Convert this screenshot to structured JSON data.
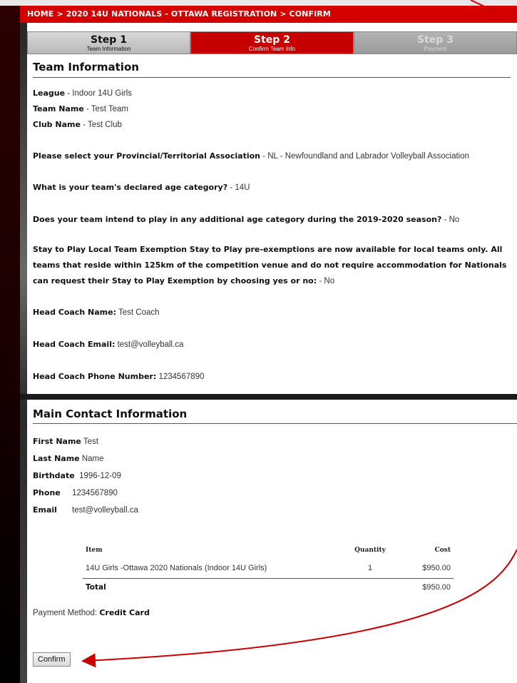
{
  "breadcrumb": "HOME > 2020 14U NATIONALS - OTTAWA REGISTRATION > CONFIRM",
  "steps": [
    {
      "title": "Step 1",
      "sub": "Team Information"
    },
    {
      "title": "Step 2",
      "sub": "Confirm Team Info"
    },
    {
      "title": "Step 3",
      "sub": "Payment"
    }
  ],
  "team": {
    "heading": "Team Information",
    "league_label": "League",
    "league": "Indoor 14U Girls",
    "team_name_label": "Team Name",
    "team_name": "Test Team",
    "club_name_label": "Club Name",
    "club_name": "Test Club",
    "q_association": "Please select your Provincial/Territorial Association",
    "a_association": "NL - Newfoundland and Labrador Volleyball Association",
    "q_age": "What is your team's declared age category?",
    "a_age": "14U",
    "q_additional": "Does your team intend to play in any additional age category during the 2019-2020 season?",
    "a_additional": "No",
    "q_stay": "Stay to Play Local Team Exemption Stay to Play pre-exemptions are now available for local teams only. All teams that reside within 125km of the competition venue and do not require accommodation for Nationals can request their Stay to Play Exemption by choosing yes or no:",
    "a_stay": "No",
    "coach_name_label": "Head Coach Name:",
    "coach_name": "Test Coach",
    "coach_email_label": "Head Coach Email:",
    "coach_email": "test@volleyball.ca",
    "coach_phone_label": "Head Coach Phone Number:",
    "coach_phone": "1234567890"
  },
  "contact": {
    "heading": "Main Contact Information",
    "first_name_label": "First Name",
    "first_name": "Test",
    "last_name_label": "Last Name",
    "last_name": "Name",
    "birthdate_label": "Birthdate",
    "birthdate": "1996-12-09",
    "phone_label": "Phone",
    "phone": "1234567890",
    "email_label": "Email",
    "email": "test@volleyball.ca"
  },
  "cart": {
    "headers": {
      "item": "Item",
      "quantity": "Quantity",
      "cost": "Cost"
    },
    "rows": [
      {
        "item": "14U Girls -Ottawa 2020 Nationals (Indoor 14U Girls)",
        "quantity": "1",
        "cost": "$950.00"
      }
    ],
    "total_label": "Total",
    "total": "$950.00"
  },
  "payment": {
    "label": "Payment Method:",
    "method": "Credit Card"
  },
  "confirm_label": "Confirm",
  "colors": {
    "accent": "#d40000",
    "annotation": "#cc0000"
  }
}
